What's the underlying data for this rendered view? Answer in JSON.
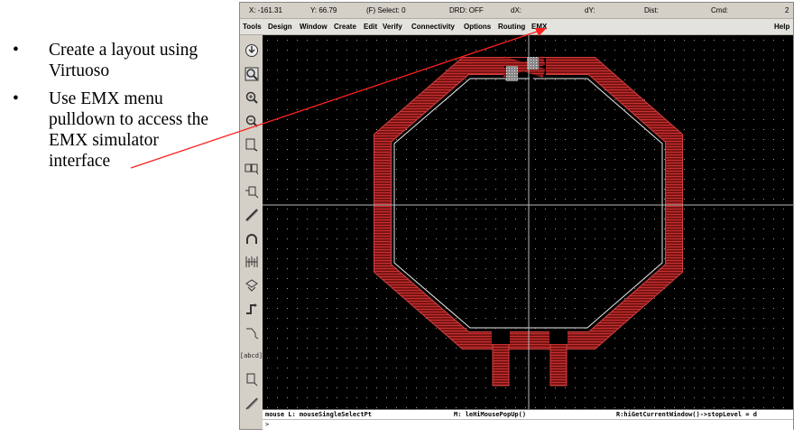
{
  "slide": {
    "bullets": [
      {
        "marker": "•",
        "text": "Create a layout using Virtuoso"
      },
      {
        "marker": "•",
        "text": "Use EMX menu pulldown to access the EMX simulator interface"
      }
    ]
  },
  "window": {
    "status": {
      "x": "X: -161.31",
      "y": "Y: 66.79",
      "select": "(F) Select: 0",
      "drd": "DRD: OFF",
      "dx": "dX:",
      "dy": "dY:",
      "dist": "Dist:",
      "cmd": "Cmd:",
      "num": "2"
    },
    "menu": [
      "Tools",
      "Design",
      "Window",
      "Create",
      "Edit",
      "Verify",
      "Connectivity",
      "Options",
      "Routing",
      "EMX"
    ],
    "help": "Help",
    "tools": [
      "stop-icon",
      "zoom-fit-icon",
      "zoom-in-icon",
      "zoom-out-icon",
      "stretch-icon",
      "copy-icon",
      "move-icon",
      "path-icon",
      "arc-icon",
      "via-icon",
      "delete-icon",
      "route-icon",
      "select-icon",
      "label-icon",
      "ruler-icon",
      "pencil-icon"
    ],
    "tool_label": "[abcd]",
    "cmd_line": {
      "left": "mouse L: mouseSingleSelectPt",
      "mid": "M: leHiMousePopUp()",
      "right": "R:hiGetCurrentWindow()->stopLevel = d"
    },
    "prompt": ">",
    "colors": {
      "metal": "#7a1414",
      "metal_edge": "#d24040",
      "canvas": "#000000",
      "arrow": "#ff2020"
    }
  }
}
